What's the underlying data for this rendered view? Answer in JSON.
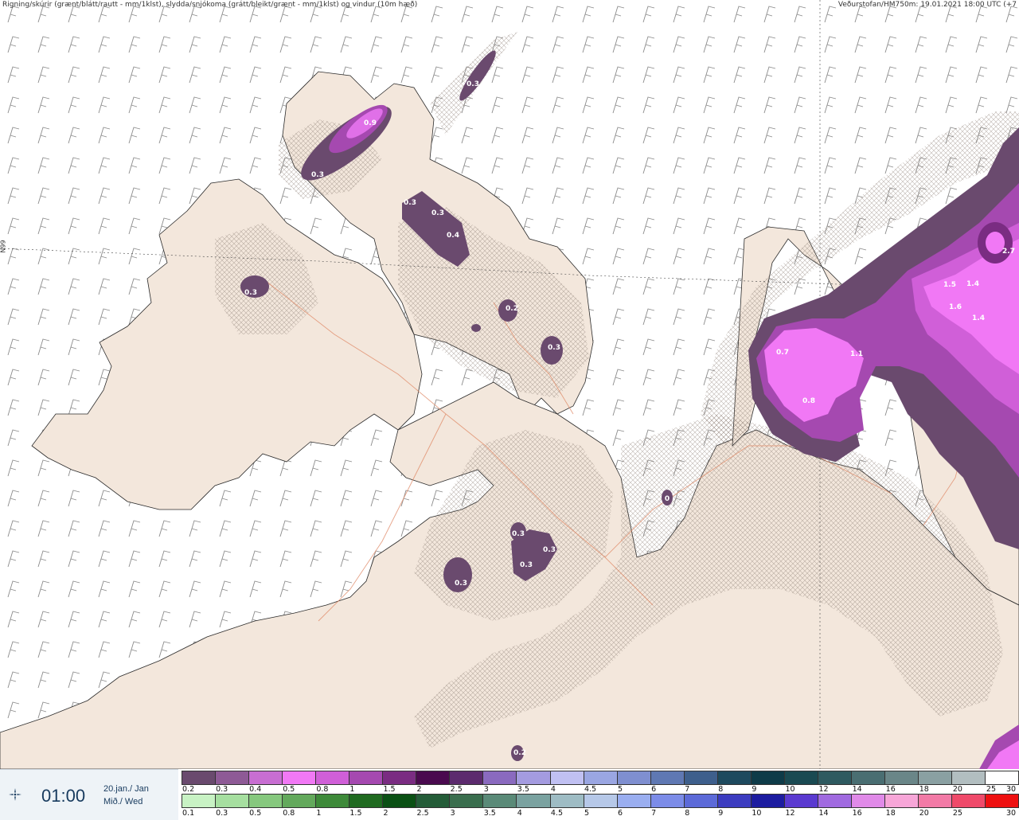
{
  "header": {
    "left_text": "Rigning/skúrir (grænt/blátt/rautt - mm/1klst), slydda/snjókoma (grátt/bleikt/grænt - mm/1klst) og vindur (10m hæð)",
    "right_text": "Veðurstofan/HM750m: 19.01.2021 18:00 UTC (+7",
    "side_label": "N99"
  },
  "time_panel": {
    "icon": "wind-sun-icon",
    "time": "01:00",
    "date_line1": "20.jan./ Jan",
    "date_line2": "Mið./ Wed"
  },
  "map": {
    "precip_labels": [
      {
        "text": "0.3",
        "region": "north-tip"
      },
      {
        "text": "0.9",
        "region": "north-peninsula"
      },
      {
        "text": "0.3",
        "region": "north-peninsula"
      },
      {
        "text": "0.3",
        "region": "north-central"
      },
      {
        "text": "0.3",
        "region": "north-central"
      },
      {
        "text": "0.4",
        "region": "north-central"
      },
      {
        "text": "0.3",
        "region": "west-fjords"
      },
      {
        "text": "0.2",
        "region": "central"
      },
      {
        "text": "0.3",
        "region": "central-east"
      },
      {
        "text": "0.3",
        "region": "south-central"
      },
      {
        "text": "0.3",
        "region": "south-central"
      },
      {
        "text": "0.3",
        "region": "south-central"
      },
      {
        "text": "0.3",
        "region": "south-west"
      },
      {
        "text": "0.2",
        "region": "south"
      },
      {
        "text": "0.7",
        "region": "east-peninsula"
      },
      {
        "text": "1.1",
        "region": "east-peninsula"
      },
      {
        "text": "0.8",
        "region": "east-peninsula"
      },
      {
        "text": "1.5",
        "region": "far-east"
      },
      {
        "text": "1.4",
        "region": "far-east"
      },
      {
        "text": "1.6",
        "region": "far-east"
      },
      {
        "text": "1.4",
        "region": "far-east"
      },
      {
        "text": "2.7",
        "region": "far-east"
      },
      {
        "text": "0",
        "region": "east-valley"
      }
    ]
  },
  "legend": {
    "snow_scale": {
      "colors": [
        "#6a4a6e",
        "#8e5a96",
        "#c86ed2",
        "#f178f5",
        "#d05fd8",
        "#a549b0",
        "#7a2c82",
        "#4a0a4f",
        "#5c2a6e",
        "#8a6abf",
        "#a49be0",
        "#c0c0f2",
        "#9aa6e2",
        "#7f8fd0",
        "#5f78b3",
        "#3e5f8c",
        "#1e4a5e",
        "#0e3b48",
        "#1a4a52",
        "#2e5a60",
        "#4a6e72",
        "#6a8688",
        "#8aa0a2",
        "#b2bec0",
        "#ffffff"
      ],
      "ticks": [
        "0.2",
        "0.3",
        "0.4",
        "0.5",
        "0.8",
        "1",
        "1.5",
        "2",
        "2.5",
        "3",
        "3.5",
        "4",
        "4.5",
        "5",
        "6",
        "7",
        "8",
        "9",
        "10",
        "12",
        "14",
        "16",
        "18",
        "20",
        "25",
        "30"
      ]
    },
    "rain_scale": {
      "colors": [
        "#c8f2c4",
        "#a6dfa0",
        "#86c87e",
        "#63a95c",
        "#3e8a3a",
        "#1f6a20",
        "#0a5014",
        "#245c38",
        "#3a6e4e",
        "#5a8a78",
        "#7aa2a0",
        "#9ebcc4",
        "#b6c8e8",
        "#9aaef0",
        "#7c8ce8",
        "#5c6ad8",
        "#3c3cc0",
        "#1c1ca0",
        "#5a3ad0",
        "#a06ae0",
        "#e08ae8",
        "#f7a6d8",
        "#f27aa6",
        "#ef4a6a",
        "#ee1010"
      ],
      "ticks": [
        "0.1",
        "0.3",
        "0.5",
        "0.8",
        "1",
        "1.5",
        "2",
        "2.5",
        "3",
        "3.5",
        "4",
        "4.5",
        "5",
        "6",
        "7",
        "8",
        "9",
        "10",
        "12",
        "14",
        "16",
        "18",
        "20",
        "25",
        "30"
      ]
    }
  }
}
